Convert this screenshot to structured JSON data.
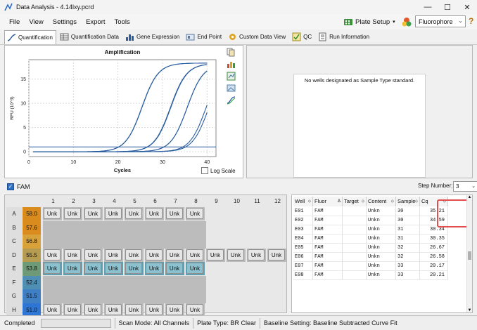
{
  "window": {
    "title": "Data Analysis - 4.14lxy.pcrd",
    "minimize": "—",
    "maximize": "☐",
    "close": "✕"
  },
  "menu": {
    "file": "File",
    "view": "View",
    "settings": "Settings",
    "export": "Export",
    "tools": "Tools"
  },
  "toolbar": {
    "plate_setup": "Plate Setup",
    "fluorophore_selected": "Fluorophore",
    "help": "?"
  },
  "tabs": [
    {
      "label": "Quantification",
      "icon": "amplification-icon",
      "active": true
    },
    {
      "label": "Quantification Data",
      "icon": "table-icon"
    },
    {
      "label": "Gene Expression",
      "icon": "bar-chart-icon"
    },
    {
      "label": "End Point",
      "icon": "endpoint-icon"
    },
    {
      "label": "Custom Data View",
      "icon": "gear-icon"
    },
    {
      "label": "QC",
      "icon": "qc-icon"
    },
    {
      "label": "Run Information",
      "icon": "document-icon"
    }
  ],
  "chart_data": {
    "type": "line",
    "title": "Amplification",
    "xlabel": "Cycles",
    "ylabel": "RFU (10^3)",
    "xlim": [
      0,
      42
    ],
    "ylim": [
      -1,
      19
    ],
    "xticks": [
      0,
      10,
      20,
      30,
      40
    ],
    "yticks": [
      0,
      5,
      10,
      15
    ],
    "threshold": 1.0,
    "grid": true,
    "series": [
      {
        "well": "E01",
        "ct": 35.21,
        "plateau": 18.0
      },
      {
        "well": "E02",
        "ct": 34.59,
        "plateau": 18.0
      },
      {
        "well": "E03",
        "ct": 30.34,
        "plateau": 18.1
      },
      {
        "well": "E04",
        "ct": 30.35,
        "plateau": 18.1
      },
      {
        "well": "E05",
        "ct": 26.67,
        "plateau": 18.2
      },
      {
        "well": "E06",
        "ct": 26.58,
        "plateau": 18.2
      },
      {
        "well": "E07",
        "ct": 20.17,
        "plateau": 18.3
      },
      {
        "well": "E08",
        "ct": 20.21,
        "plateau": 18.3
      }
    ],
    "log_scale_label": "Log Scale"
  },
  "std_curve": {
    "message": "No wells designated as Sample Type standard."
  },
  "fam": {
    "label": "FAM",
    "step_label": "Step Number:",
    "step_value": "3"
  },
  "plate": {
    "columns": [
      "1",
      "2",
      "3",
      "4",
      "5",
      "6",
      "7",
      "8",
      "9",
      "10",
      "11",
      "12"
    ],
    "rows": [
      {
        "label": "A",
        "temp": "58.0",
        "temp_color": "#d98b1e",
        "wells": [
          "Unk",
          "Unk",
          "Unk",
          "Unk",
          "Unk",
          "Unk",
          "Unk",
          "Unk"
        ],
        "style": "normal"
      },
      {
        "label": "B",
        "temp": "57.6",
        "temp_color": "#d98b1e",
        "wells": [],
        "style": "empty"
      },
      {
        "label": "C",
        "temp": "56.8",
        "temp_color": "#d9a13a",
        "wells": [],
        "style": "empty"
      },
      {
        "label": "D",
        "temp": "55.5",
        "temp_color": "#b59c50",
        "wells": [
          "Unk",
          "Unk",
          "Unk",
          "Unk",
          "Unk",
          "Unk",
          "Unk",
          "Unk",
          "Unk",
          "Unk",
          "Unk",
          "Unk"
        ],
        "style": "normal"
      },
      {
        "label": "E",
        "temp": "53.8",
        "temp_color": "#6e9a78",
        "wells": [
          "Unk",
          "Unk",
          "Unk",
          "Unk",
          "Unk",
          "Unk",
          "Unk",
          "Unk"
        ],
        "style": "selected"
      },
      {
        "label": "F",
        "temp": "52.4",
        "temp_color": "#4f8fb4",
        "wells": [],
        "style": "empty"
      },
      {
        "label": "G",
        "temp": "51.5",
        "temp_color": "#3f7fc4",
        "wells": [],
        "style": "empty"
      },
      {
        "label": "H",
        "temp": "51.0",
        "temp_color": "#2f76d4",
        "wells": [
          "Unk",
          "Unk",
          "Unk",
          "Unk",
          "Unk",
          "Unk",
          "Unk",
          "Unk"
        ],
        "style": "normal"
      }
    ]
  },
  "table": {
    "headers": [
      "Well",
      "Fluor",
      "Target",
      "Content",
      "Sample",
      "Cq"
    ],
    "rows": [
      {
        "well": "E01",
        "fluor": "FAM",
        "target": "",
        "content": "Unkn",
        "sample": "30",
        "cq": "35.21"
      },
      {
        "well": "E02",
        "fluor": "FAM",
        "target": "",
        "content": "Unkn",
        "sample": "30",
        "cq": "34.59"
      },
      {
        "well": "E03",
        "fluor": "FAM",
        "target": "",
        "content": "Unkn",
        "sample": "31",
        "cq": "30.34"
      },
      {
        "well": "E04",
        "fluor": "FAM",
        "target": "",
        "content": "Unkn",
        "sample": "31",
        "cq": "30.35"
      },
      {
        "well": "E05",
        "fluor": "FAM",
        "target": "",
        "content": "Unkn",
        "sample": "32",
        "cq": "26.67"
      },
      {
        "well": "E06",
        "fluor": "FAM",
        "target": "",
        "content": "Unkn",
        "sample": "32",
        "cq": "26.58"
      },
      {
        "well": "E07",
        "fluor": "FAM",
        "target": "",
        "content": "Unkn",
        "sample": "33",
        "cq": "20.17"
      },
      {
        "well": "E08",
        "fluor": "FAM",
        "target": "",
        "content": "Unkn",
        "sample": "33",
        "cq": "20.21"
      }
    ]
  },
  "status": {
    "completed": "Completed",
    "scan_mode": "Scan Mode: All Channels",
    "plate_type": "Plate Type: BR Clear",
    "baseline": "Baseline Setting: Baseline Subtracted Curve Fit"
  },
  "colors": {
    "curve": "#2a5d9f",
    "selected_well": "#5f9fb0",
    "highlight": "#e05050"
  }
}
